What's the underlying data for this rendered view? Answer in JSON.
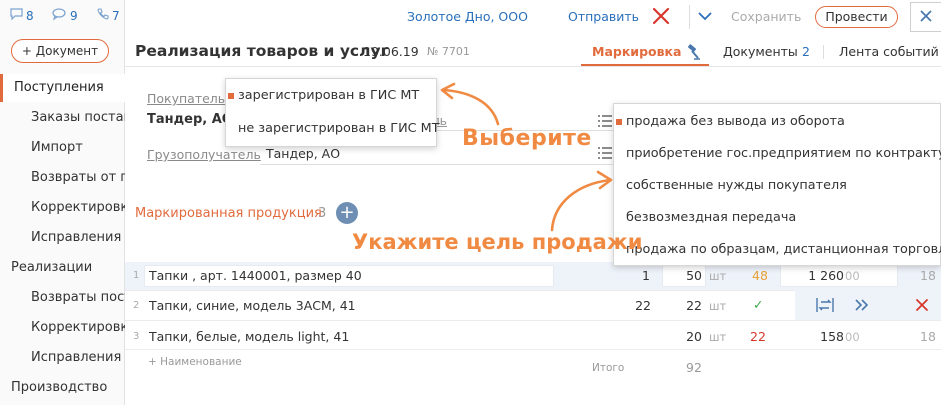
{
  "sidebar": {
    "counters": [
      {
        "icon": "message-icon",
        "value": "8"
      },
      {
        "icon": "chat-icon",
        "value": "9"
      },
      {
        "icon": "phone-icon",
        "value": "7"
      }
    ],
    "add_button": "+ Документ",
    "items": [
      {
        "label": "Поступления",
        "level": "top",
        "active": true
      },
      {
        "label": "Заказы поставщикам",
        "level": "sub"
      },
      {
        "label": "Импорт",
        "level": "sub"
      },
      {
        "label": "Возвраты от покупателей",
        "level": "sub"
      },
      {
        "label": "Корректировки",
        "level": "sub"
      },
      {
        "label": "Исправления",
        "level": "sub"
      },
      {
        "label": "Реализации",
        "level": "top"
      },
      {
        "label": "Возвраты поставщикам",
        "level": "sub"
      },
      {
        "label": "Корректировки",
        "level": "sub"
      },
      {
        "label": "Исправления",
        "level": "sub"
      },
      {
        "label": "Производство",
        "level": "top"
      }
    ]
  },
  "header": {
    "org": "Золотое Дно, ООО",
    "send": "Отправить",
    "save": "Сохранить",
    "post": "Провести",
    "title": "Реализация товаров и услуг",
    "date": "19.06.19",
    "number": "№ 7701",
    "tabs": {
      "marking": "Маркировка",
      "documents": "Документы",
      "documents_count": "2",
      "feed": "Лента событий"
    }
  },
  "form": {
    "buyer_label": "Покупатель",
    "buyer_value": "Тандер, АО",
    "hidden_label": "ель",
    "consignee_label": "Грузополучатель",
    "consignee_value": "Тандер, АО"
  },
  "popup_registration": {
    "options": [
      "зарегистрирован в ГИС МТ",
      "не зарегистрирован в ГИС МТ"
    ]
  },
  "popup_purpose": {
    "options": [
      "продажа без вывода из оборота",
      "приобретение гос.предприятием по контракту",
      "собственные нужды покупателя",
      "безвозмездная передача",
      "продажа по образцам, дистанционная торговля"
    ]
  },
  "products": {
    "title": "Маркированная продукция",
    "count": "3",
    "add_button": "+",
    "rows": [
      {
        "n": "1",
        "name": "Тапки , арт. 1440001, размер 40",
        "qty": "1",
        "qty2": "50",
        "unit": "шт",
        "status": "48",
        "sum": "1 260",
        "cents": "00",
        "extra": "18"
      },
      {
        "n": "2",
        "name": "Тапки, синие, модель 3АСМ, 41",
        "qty": "22",
        "qty2": "22",
        "unit": "шт",
        "status": "✓",
        "sum": "",
        "cents": "",
        "extra": ""
      },
      {
        "n": "3",
        "name": "Тапки, белые, модель light, 41",
        "qty": "",
        "qty2": "20",
        "unit": "шт",
        "status": "22",
        "sum": "158",
        "cents": "00",
        "extra": "18"
      }
    ],
    "add_name": "+ Наименование",
    "total_label": "Итого",
    "total_value": "92"
  },
  "annotations": {
    "choose": "Выберите",
    "purpose": "Укажите цель продажи"
  },
  "colors": {
    "accent": "#e26b3e",
    "link": "#2a6fba",
    "annotation": "#f08a42"
  }
}
